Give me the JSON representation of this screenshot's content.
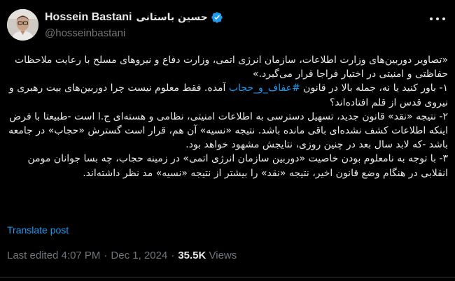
{
  "author": {
    "display_name": "Hossein Bastani",
    "display_name_fa": "حسین باستانی",
    "handle": "@hosseinbastani",
    "verified_icon": "verified-badge-icon",
    "avatar_icon": "avatar-photo"
  },
  "tweet": {
    "p1": "«تصاویر دوربین‌های وزارت اطلاعات، سازمان انرژی اتمی، وزارت دفاع و نیروهای مسلح با رعایت ملاحظات حفاظتی و امنیتی در اختیار فراجا قرار می‌گیرد.»",
    "p2_before": "۱- باور کنید یا نه، جمله بالا در قانون ",
    "p2_hashtag": "#عفاف_و_حجاب",
    "p2_after": " آمده. فقط معلوم نیست چرا دوربین‌های بیت رهبری و نیروی قدس از قلم افتاده‌اند؟",
    "p3": "۲- نتیجه «نقد» قانون جدید، تسهیل دسترسی به اطلاعات امنیتی، نظامی و هسته‌ای ج.ا است -طبیعتا با فرض اینکه اطلاعات کشف نشده‌ای باقی مانده باشد. نتیجه «نسیه» آن هم، قرار است گسترش «حجاب» در جامعه باشد -که لابد سال بعد در چنین روزی، نتایجش مشهود خواهد بود.",
    "p4": "۳- با توجه به نامعلوم بودن خاصیت «دوربین سازمان انرژی اتمی» در زمینه حجاب، چه بسا جوانان مومن انقلابی در هنگام وضع قانون اخیر، نتیجه «نقد» را بیشتر از نتیجه «نسیه» مد نظر داشته‌اند."
  },
  "translate_label": "Translate post",
  "meta": {
    "edited": "Last edited 4:07 PM",
    "separator": "·",
    "date": "Dec 1, 2024",
    "views_count": "35.5K",
    "views_label": "Views"
  },
  "colors": {
    "background": "#000000",
    "text": "#e7e9ea",
    "secondary": "#71767b",
    "accent": "#1d9bf0"
  },
  "more_icon": "more-options-icon"
}
